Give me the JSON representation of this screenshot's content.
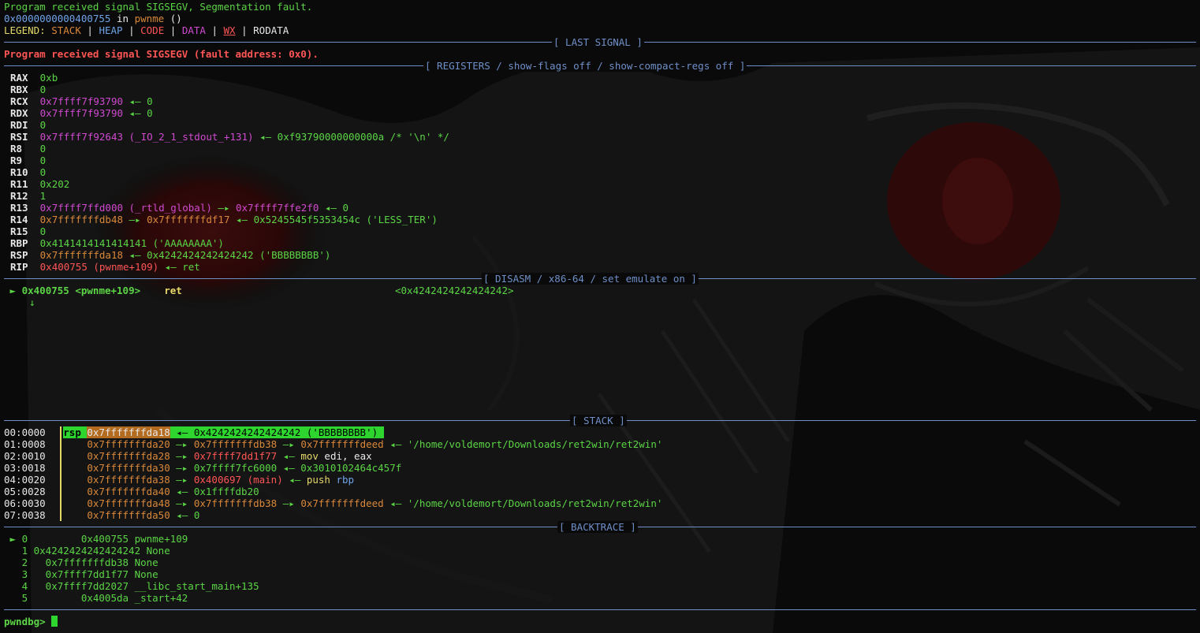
{
  "header": {
    "signal_line": "Program received signal SIGSEGV, Segmentation fault.",
    "frame_addr": "0x0000000000400755",
    "frame_in": " in ",
    "frame_func": "pwnme",
    "frame_args": " ()",
    "legend_prefix": "LEGEND: ",
    "legend": {
      "stack": "STACK",
      "heap": "HEAP",
      "code": "CODE",
      "data": "DATA",
      "wx": "WX",
      "rodata": "RODATA",
      "sep": " | "
    }
  },
  "sections": {
    "last_signal": "[ LAST SIGNAL ]",
    "registers": "[ REGISTERS / show-flags off / show-compact-regs off ]",
    "disasm": "[ DISASM / x86-64 / set emulate on ]",
    "stack": "[ STACK ]",
    "backtrace": "[ BACKTRACE ]"
  },
  "last_signal_msg": "Program received signal SIGSEGV (fault address: 0x0).",
  "registers": [
    {
      "name": "RAX",
      "parts": [
        {
          "t": "0xb",
          "c": "g"
        }
      ]
    },
    {
      "name": "RBX",
      "parts": [
        {
          "t": "0",
          "c": "g"
        }
      ]
    },
    {
      "name": "RCX",
      "parts": [
        {
          "t": "0x7ffff7f93790",
          "c": "m"
        },
        {
          "t": " ◂— ",
          "c": "g"
        },
        {
          "t": "0",
          "c": "g"
        }
      ]
    },
    {
      "name": "RDX",
      "parts": [
        {
          "t": "0x7ffff7f93790",
          "c": "m"
        },
        {
          "t": " ◂— ",
          "c": "g"
        },
        {
          "t": "0",
          "c": "g"
        }
      ]
    },
    {
      "name": "RDI",
      "parts": [
        {
          "t": "0",
          "c": "g"
        }
      ]
    },
    {
      "name": "RSI",
      "parts": [
        {
          "t": "0x7ffff7f92643 (_IO_2_1_stdout_+131)",
          "c": "m"
        },
        {
          "t": " ◂— 0xf93790000000000a /* '\\n' */",
          "c": "g"
        }
      ]
    },
    {
      "name": "R8",
      "parts": [
        {
          "t": "0",
          "c": "g"
        }
      ]
    },
    {
      "name": "R9",
      "parts": [
        {
          "t": "0",
          "c": "g"
        }
      ]
    },
    {
      "name": "R10",
      "parts": [
        {
          "t": "0",
          "c": "g"
        }
      ]
    },
    {
      "name": "R11",
      "parts": [
        {
          "t": "0x202",
          "c": "g"
        }
      ]
    },
    {
      "name": "R12",
      "parts": [
        {
          "t": "1",
          "c": "g"
        }
      ]
    },
    {
      "name": "R13",
      "parts": [
        {
          "t": "0x7ffff7ffd000 (_rtld_global)",
          "c": "m"
        },
        {
          "t": " —▸ ",
          "c": "g"
        },
        {
          "t": "0x7ffff7ffe2f0",
          "c": "m"
        },
        {
          "t": " ◂— 0",
          "c": "g"
        }
      ]
    },
    {
      "name": "R14",
      "parts": [
        {
          "t": "0x7fffffffdb48",
          "c": "o"
        },
        {
          "t": " —▸ ",
          "c": "g"
        },
        {
          "t": "0x7fffffffdf17",
          "c": "o"
        },
        {
          "t": " ◂— 0x5245545f5353454c ('LESS_TER')",
          "c": "g"
        }
      ]
    },
    {
      "name": "R15",
      "parts": [
        {
          "t": "0",
          "c": "g"
        }
      ]
    },
    {
      "name": "RBP",
      "parts": [
        {
          "t": "0x4141414141414141 ('AAAAAAAA')",
          "c": "g"
        }
      ]
    },
    {
      "name": "RSP",
      "parts": [
        {
          "t": "0x7fffffffda18",
          "c": "o"
        },
        {
          "t": " ◂— 0x4242424242424242 ('BBBBBBBB')",
          "c": "g"
        }
      ]
    },
    {
      "name": "RIP",
      "parts": [
        {
          "t": "0x400755 (pwnme+109)",
          "c": "r"
        },
        {
          "t": " ◂— ret",
          "c": "g"
        }
      ]
    }
  ],
  "disasm": {
    "marker": "►",
    "addr": "0x400755",
    "sym": "<pwnme+109>",
    "op": "ret",
    "target": "<0x4242424242424242>",
    "down_arrow": "↓"
  },
  "stack": [
    {
      "idx": "00:0000",
      "rsp": "rsp",
      "addr": "0x7fffffffda18",
      "rest": [
        {
          "t": " ◂— 0x4242424242424242 ('BBBBBBBB') ",
          "c": "hl"
        }
      ]
    },
    {
      "idx": "01:0008",
      "addr": "0x7fffffffda20",
      "rest": [
        {
          "t": " —▸ ",
          "c": "g"
        },
        {
          "t": "0x7fffffffdb38",
          "c": "o"
        },
        {
          "t": " —▸ ",
          "c": "g"
        },
        {
          "t": "0x7fffffffdeed",
          "c": "o"
        },
        {
          "t": " ◂— '/home/voldemort/Downloads/ret2win/ret2win'",
          "c": "g"
        }
      ]
    },
    {
      "idx": "02:0010",
      "addr": "0x7fffffffda28",
      "rest": [
        {
          "t": " —▸ ",
          "c": "g"
        },
        {
          "t": "0x7ffff7dd1f77",
          "c": "r"
        },
        {
          "t": " ◂— ",
          "c": "g"
        },
        {
          "t": "mov",
          "c": "y"
        },
        {
          "t": " edi, eax",
          "c": "w"
        }
      ]
    },
    {
      "idx": "03:0018",
      "addr": "0x7fffffffda30",
      "rest": [
        {
          "t": " —▸ ",
          "c": "g"
        },
        {
          "t": "0x7ffff7fc6000",
          "c": "g"
        },
        {
          "t": " ◂— 0x3010102464c457f",
          "c": "g"
        }
      ]
    },
    {
      "idx": "04:0020",
      "addr": "0x7fffffffda38",
      "rest": [
        {
          "t": " —▸ ",
          "c": "g"
        },
        {
          "t": "0x400697 (main)",
          "c": "r"
        },
        {
          "t": " ◂— ",
          "c": "g"
        },
        {
          "t": "push",
          "c": "y"
        },
        {
          "t": " rbp",
          "c": "b"
        }
      ]
    },
    {
      "idx": "05:0028",
      "addr": "0x7fffffffda40",
      "rest": [
        {
          "t": " ◂— 0x1ffffdb20",
          "c": "g"
        }
      ]
    },
    {
      "idx": "06:0030",
      "addr": "0x7fffffffda48",
      "rest": [
        {
          "t": " —▸ ",
          "c": "g"
        },
        {
          "t": "0x7fffffffdb38",
          "c": "o"
        },
        {
          "t": " —▸ ",
          "c": "g"
        },
        {
          "t": "0x7fffffffdeed",
          "c": "o"
        },
        {
          "t": " ◂— '/home/voldemort/Downloads/ret2win/ret2win'",
          "c": "g"
        }
      ]
    },
    {
      "idx": "07:0038",
      "addr": "0x7fffffffda50",
      "rest": [
        {
          "t": " ◂— 0",
          "c": "g"
        }
      ]
    }
  ],
  "backtrace": [
    {
      "line": " ► 0         0x400755 pwnme+109"
    },
    {
      "line": "   1 0x4242424242424242 None"
    },
    {
      "line": "   2   0x7fffffffdb38 None"
    },
    {
      "line": "   3   0x7ffff7dd1f77 None"
    },
    {
      "line": "   4   0x7ffff7dd2027 __libc_start_main+135"
    },
    {
      "line": "   5         0x4005da _start+42"
    }
  ],
  "prompt": "pwndbg> "
}
